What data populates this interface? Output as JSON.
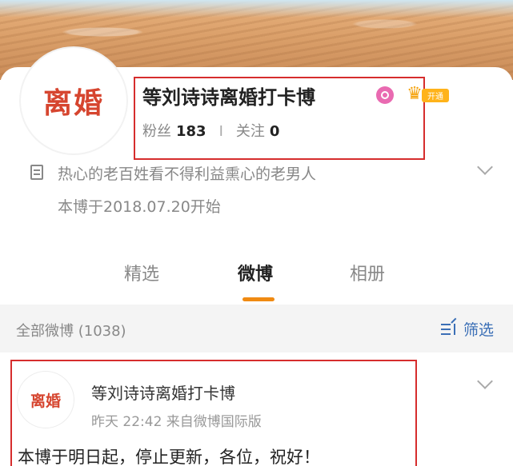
{
  "profile": {
    "avatar_text": "离婚",
    "name": "等刘诗诗离婚打卡博",
    "vip_label": "开通",
    "fans_label": "粉丝",
    "fans_count": "183",
    "sep": "I",
    "follow_label": "关注",
    "follow_count": "0",
    "bio": "热心的老百姓看不得利益熏心的老男人",
    "since": "本博于2018.07.20开始"
  },
  "tabs": [
    {
      "label": "精选"
    },
    {
      "label": "微博",
      "active": true
    },
    {
      "label": "相册"
    }
  ],
  "filter": {
    "label": "全部微博 (1038)",
    "button_label": "筛选"
  },
  "post": {
    "avatar_text": "离婚",
    "author": "等刘诗诗离婚打卡博",
    "time": "昨天 22:42  来自微博国际版",
    "text": "本博于明日起，停止更新，各位，祝好！"
  },
  "colors": {
    "accent": "#f08a12",
    "highlight": "#d62d2d",
    "link": "#3b6fb6",
    "avatar_text": "#d6452f"
  }
}
